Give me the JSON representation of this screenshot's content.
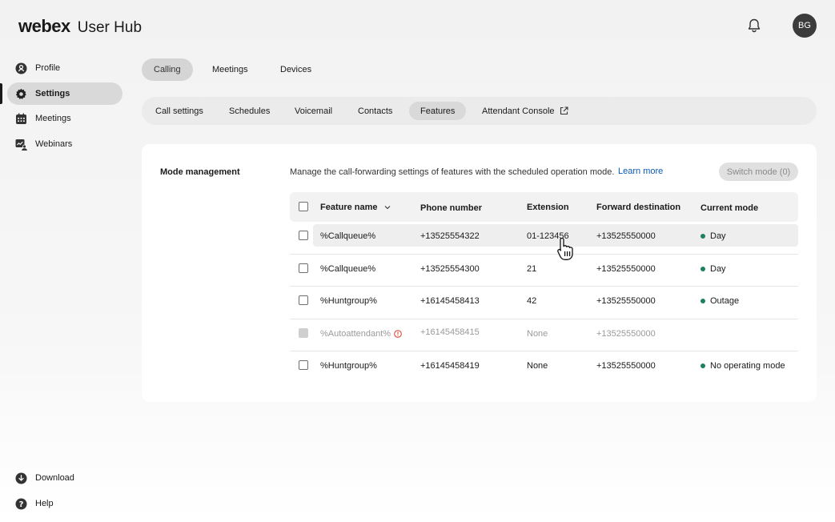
{
  "header": {
    "logo": "webex",
    "title": "User Hub",
    "avatar_initials": "BG",
    "bell_icon": "bell-icon"
  },
  "sidebar": {
    "items": [
      {
        "label": "Profile",
        "icon": "profile-icon",
        "active": false
      },
      {
        "label": "Settings",
        "icon": "gear-icon",
        "active": true
      },
      {
        "label": "Meetings",
        "icon": "calendar-icon",
        "active": false
      },
      {
        "label": "Webinars",
        "icon": "webinar-icon",
        "active": false
      }
    ],
    "bottom": [
      {
        "label": "Download",
        "icon": "download-icon"
      },
      {
        "label": "Help",
        "icon": "help-icon"
      }
    ]
  },
  "top_tabs": [
    {
      "label": "Calling",
      "active": true
    },
    {
      "label": "Meetings",
      "active": false
    },
    {
      "label": "Devices",
      "active": false
    }
  ],
  "sub_tabs": [
    {
      "label": "Call settings",
      "active": false
    },
    {
      "label": "Schedules",
      "active": false
    },
    {
      "label": "Voicemail",
      "active": false
    },
    {
      "label": "Contacts",
      "active": false
    },
    {
      "label": "Features",
      "active": true
    },
    {
      "label": "Attendant Console",
      "active": false,
      "icon": "external-link-icon"
    }
  ],
  "mode_management": {
    "title": "Mode management",
    "description": "Manage the call-forwarding settings of features with the scheduled operation mode.",
    "learn_more": "Learn more",
    "switch_button": "Switch mode (0)"
  },
  "table": {
    "columns": [
      "Feature name",
      "Phone number",
      "Extension",
      "Forward destination",
      "Current mode"
    ],
    "rows": [
      {
        "name": "%Callqueue%",
        "phone": "+13525554322",
        "extension": "01-123456",
        "forward": "+13525550000",
        "mode": "Day",
        "disabled": false,
        "hover": true
      },
      {
        "name": "%Callqueue%",
        "phone": "+13525554300",
        "extension": "21",
        "forward": "+13525550000",
        "mode": "Day",
        "disabled": false
      },
      {
        "name": "%Huntgroup%",
        "phone": "+16145458413",
        "extension": "42",
        "forward": "+13525550000",
        "mode": "Outage",
        "disabled": false
      },
      {
        "name": "%Autoattendant%",
        "phone": "+16145458415",
        "extension": "None",
        "forward": "+13525550000",
        "mode": "",
        "disabled": true
      },
      {
        "name": "%Huntgroup%",
        "phone": "+16145458419",
        "extension": "None",
        "forward": "+13525550000",
        "mode": "No operating mode",
        "disabled": false
      }
    ]
  },
  "colors": {
    "status_green": "#1d8160",
    "link_blue": "#0a58b5"
  }
}
